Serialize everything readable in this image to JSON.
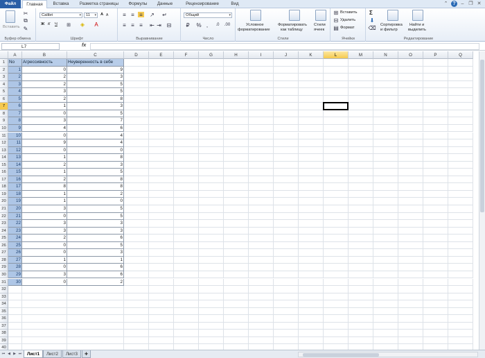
{
  "ribbon_tabs": [
    "Файл",
    "Главная",
    "Вставка",
    "Разметка страницы",
    "Формулы",
    "Данные",
    "Рецензирование",
    "Вид"
  ],
  "clipboard": {
    "paste_label": "Вставить",
    "group": "Буфер обмена"
  },
  "font": {
    "family": "Calibri",
    "size": "11",
    "bold": "Ж",
    "italic": "К",
    "underline": "Ч",
    "grow": "A",
    "shrink": "A",
    "group": "Шрифт"
  },
  "alignment": {
    "group": "Выравнивание"
  },
  "number": {
    "format": "Общий",
    "group": "Число"
  },
  "styles": {
    "conditional": [
      "Условное",
      "форматирование"
    ],
    "as_table": [
      "Форматировать",
      "как таблицу"
    ],
    "cell_styles": [
      "Стили",
      "ячеек"
    ],
    "group": "Стили"
  },
  "cells": {
    "insert": "Вставить",
    "delete": "Удалить",
    "format": "Формат",
    "group": "Ячейки"
  },
  "editing": {
    "sum": "Σ",
    "sort": [
      "Сортировка",
      "и фильтр"
    ],
    "find": [
      "Найти и",
      "выделить"
    ],
    "group": "Редактирование"
  },
  "formula_bar": {
    "name_box": "L7",
    "fx": "fx",
    "value": ""
  },
  "columns": [
    "A",
    "B",
    "C",
    "D",
    "E",
    "F",
    "G",
    "H",
    "I",
    "J",
    "K",
    "L",
    "M",
    "N",
    "O",
    "P",
    "Q"
  ],
  "selected_column": "L",
  "selected_row": 7,
  "table": {
    "headers": [
      "No",
      "Агрессивность",
      "Неуверенность в себе"
    ],
    "rows": [
      [
        1,
        0,
        9
      ],
      [
        2,
        2,
        3
      ],
      [
        3,
        2,
        5
      ],
      [
        4,
        3,
        5
      ],
      [
        5,
        2,
        8
      ],
      [
        6,
        1,
        3
      ],
      [
        7,
        0,
        5
      ],
      [
        8,
        3,
        7
      ],
      [
        9,
        4,
        6
      ],
      [
        10,
        0,
        4
      ],
      [
        11,
        9,
        4
      ],
      [
        12,
        0,
        0
      ],
      [
        13,
        1,
        8
      ],
      [
        14,
        2,
        3
      ],
      [
        15,
        1,
        5
      ],
      [
        16,
        2,
        8
      ],
      [
        17,
        8,
        8
      ],
      [
        18,
        1,
        2
      ],
      [
        19,
        1,
        0
      ],
      [
        20,
        3,
        5
      ],
      [
        21,
        0,
        5
      ],
      [
        22,
        3,
        3
      ],
      [
        23,
        3,
        3
      ],
      [
        24,
        2,
        6
      ],
      [
        25,
        0,
        5
      ],
      [
        26,
        0,
        3
      ],
      [
        27,
        1,
        1
      ],
      [
        28,
        0,
        6
      ],
      [
        29,
        3,
        6
      ],
      [
        30,
        0,
        2
      ]
    ]
  },
  "total_rows": 40,
  "sheet_tabs": [
    "Лист1",
    "Лист2",
    "Лист3"
  ],
  "active_sheet": "Лист1"
}
